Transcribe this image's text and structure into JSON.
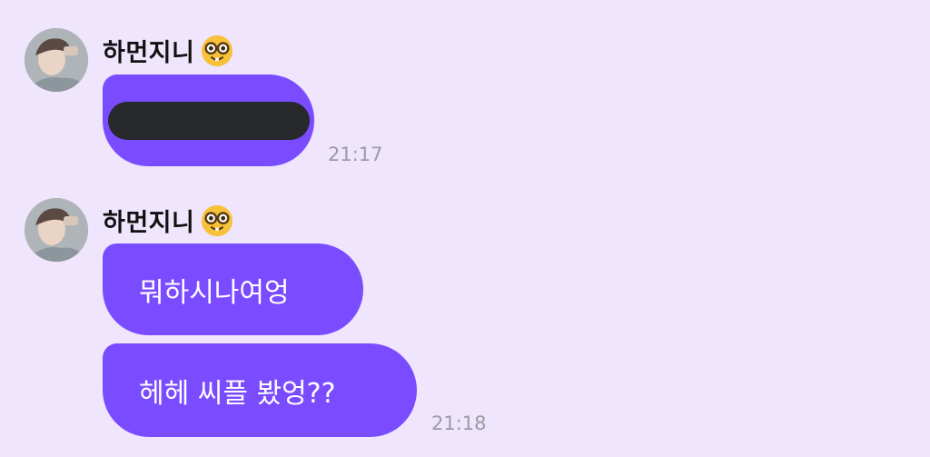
{
  "messages": [
    {
      "sender": "하먼지니",
      "bubbles": [
        {
          "text": "",
          "redacted": true
        }
      ],
      "time": "21:17"
    },
    {
      "sender": "하먼지니",
      "bubbles": [
        {
          "text": "뭐하시나여엉"
        },
        {
          "text": "헤헤 씨플 봤엉??"
        }
      ],
      "time": "21:18"
    }
  ],
  "colors": {
    "background": "#efe5fd",
    "bubble": "#7b4cff",
    "redaction": "#27292d",
    "timestamp": "#9c9aa3"
  },
  "icons": {
    "sender_emoji": "nerd-face-icon"
  }
}
